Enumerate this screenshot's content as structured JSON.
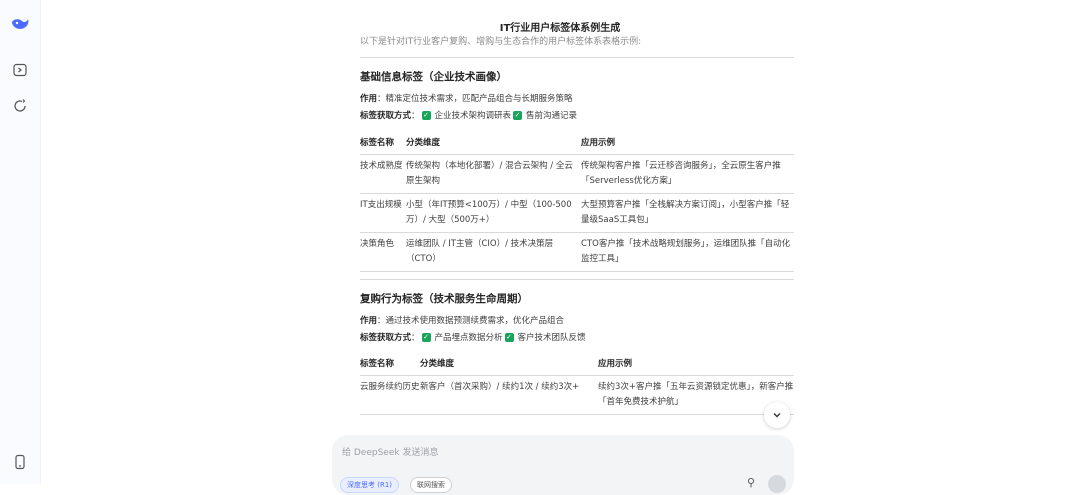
{
  "sidebar": {
    "logo_icon": "deepseek-whale-icon",
    "icons": [
      "sidebar-toggle-icon",
      "new-chat-icon",
      "mobile-app-icon"
    ],
    "accent": "#4d6bfe"
  },
  "doc": {
    "title": "IT行业用户标签体系例生成",
    "intro": "以下是针对IT行业客户复购、增购与生态合作的用户标签体系表格示例:"
  },
  "section1": {
    "heading": "基础信息标签（企业技术画像）",
    "role_label": "作用",
    "role_text": "：精准定位技术需求，匹配产品组合与长期服务策略",
    "method_label": "标签获取方式",
    "method_sep": "：",
    "methods": [
      "企业技术架构调研表",
      "售前沟通记录"
    ],
    "headers": [
      "标签名称",
      "分类维度",
      "应用示例"
    ],
    "rows": [
      [
        "技术成熟度",
        "传统架构（本地化部署）/ 混合云架构 / 全云原生架构",
        "传统架构客户推「云迁移咨询服务」，全云原生客户推「Serverless优化方案」"
      ],
      [
        "IT支出规模",
        "小型（年IT预算<100万）/ 中型（100-500万）/ 大型（500万+）",
        "大型预算客户推「全栈解决方案订阅」，小型客户推「轻量级SaaS工具包」"
      ],
      [
        "决策角色",
        "运维团队 / IT主管（CIO）/ 技术决策层（CTO）",
        "CTO客户推「技术战略规划服务」，运维团队推「自动化监控工具」"
      ]
    ]
  },
  "section2": {
    "heading": "复购行为标签（技术服务生命周期）",
    "role_label": "作用",
    "role_text": "：通过技术使用数据预测续费需求，优化产品组合",
    "method_label": "标签获取方式",
    "method_sep": "：",
    "methods": [
      "产品埋点数据分析",
      "客户技术团队反馈"
    ],
    "headers": [
      "标签名称",
      "分类维度",
      "应用示例"
    ],
    "rows": [
      [
        "云服务续约历史",
        "新客户（首次采购）/ 续约1次 / 续约3次+",
        "续约3次+客户推「五年云资源锁定优惠」，新客户推「首年免费技术护航」"
      ]
    ]
  },
  "composer": {
    "placeholder": "给 DeepSeek 发送消息",
    "deep_think": "深度思考 (R1)",
    "web_search": "联网搜索"
  }
}
